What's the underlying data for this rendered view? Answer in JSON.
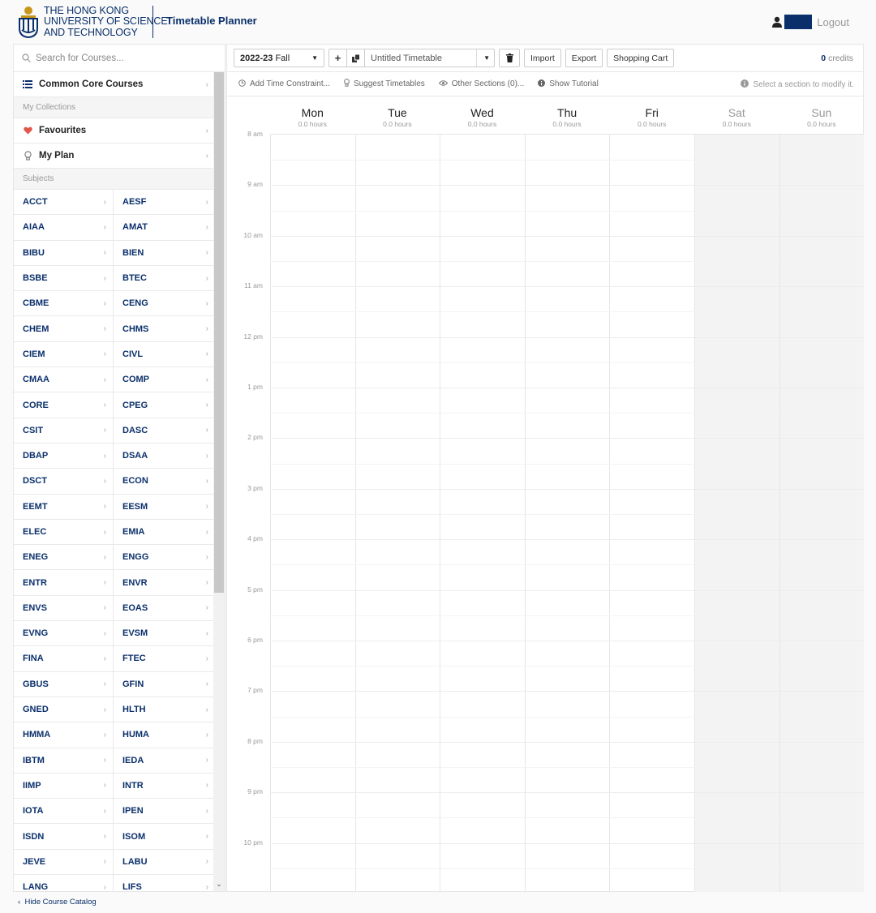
{
  "header": {
    "logo_lines": [
      "THE HONG KONG",
      "UNIVERSITY OF SCIENCE",
      "AND TECHNOLOGY"
    ],
    "app_title": "Timetable Planner",
    "logout": "Logout"
  },
  "sidebar": {
    "search_placeholder": "Search for Courses...",
    "common_core": "Common Core Courses",
    "my_collections": "My Collections",
    "favourites": "Favourites",
    "my_plan": "My Plan",
    "subjects_label": "Subjects",
    "subjects": [
      "ACCT",
      "AESF",
      "AIAA",
      "AMAT",
      "BIBU",
      "BIEN",
      "BSBE",
      "BTEC",
      "CBME",
      "CENG",
      "CHEM",
      "CHMS",
      "CIEM",
      "CIVL",
      "CMAA",
      "COMP",
      "CORE",
      "CPEG",
      "CSIT",
      "DASC",
      "DBAP",
      "DSAA",
      "DSCT",
      "ECON",
      "EEMT",
      "EESM",
      "ELEC",
      "EMIA",
      "ENEG",
      "ENGG",
      "ENTR",
      "ENVR",
      "ENVS",
      "EOAS",
      "EVNG",
      "EVSM",
      "FINA",
      "FTEC",
      "GBUS",
      "GFIN",
      "GNED",
      "HLTH",
      "HMMA",
      "HUMA",
      "IBTM",
      "IEDA",
      "IIMP",
      "INTR",
      "IOTA",
      "IPEN",
      "ISDN",
      "ISOM",
      "JEVE",
      "LABU",
      "LANG",
      "LIFS"
    ],
    "hide_catalog": "Hide Course Catalog"
  },
  "toolbar": {
    "term_year": "2022-23",
    "term_season": "Fall",
    "timetable_name": "Untitled Timetable",
    "import": "Import",
    "export": "Export",
    "shopping_cart": "Shopping Cart",
    "credits_value": "0",
    "credits_label": "credits"
  },
  "subbar": {
    "add_constraint": "Add Time Constraint...",
    "suggest": "Suggest Timetables",
    "other_sections": "Other Sections (0)...",
    "tutorial": "Show Tutorial",
    "hint": "Select a section to modify it."
  },
  "calendar": {
    "days": [
      {
        "name": "Mon",
        "hours": "0.0 hours",
        "weekend": false
      },
      {
        "name": "Tue",
        "hours": "0.0 hours",
        "weekend": false
      },
      {
        "name": "Wed",
        "hours": "0.0 hours",
        "weekend": false
      },
      {
        "name": "Thu",
        "hours": "0.0 hours",
        "weekend": false
      },
      {
        "name": "Fri",
        "hours": "0.0 hours",
        "weekend": false
      },
      {
        "name": "Sat",
        "hours": "0.0 hours",
        "weekend": true
      },
      {
        "name": "Sun",
        "hours": "0.0 hours",
        "weekend": true
      }
    ],
    "times": [
      "8 am",
      "9 am",
      "10 am",
      "11 am",
      "12 pm",
      "1 pm",
      "2 pm",
      "3 pm",
      "4 pm",
      "5 pm",
      "6 pm",
      "7 pm",
      "8 pm",
      "9 pm",
      "10 pm"
    ]
  },
  "colors": {
    "brand": "#0a2f6b",
    "accent": "#d4a017",
    "heart": "#e2574c"
  }
}
